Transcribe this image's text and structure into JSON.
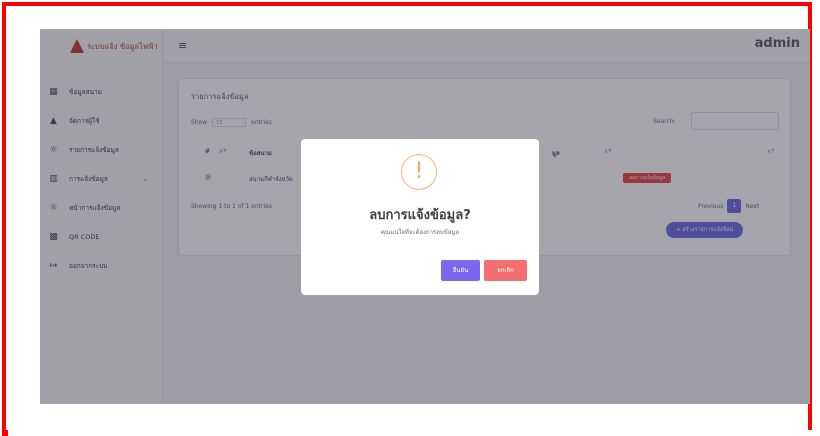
{
  "sidebar": {
    "logo_text": "ระบบแจ้ง ข้อมูลไฟฟ้า",
    "items": [
      {
        "icon": "grid-icon",
        "glyph": "▦",
        "label": "ข้อมูลสนาม"
      },
      {
        "icon": "user-icon",
        "glyph": "▲",
        "label": "จัดการผู้ใช้"
      },
      {
        "icon": "bulb-icon",
        "glyph": "☼",
        "label": "รายการแจ้งข้อมูล"
      },
      {
        "icon": "chart-icon",
        "glyph": "▥",
        "label": "การแจ้งข้อมูล",
        "has_chevron": true
      },
      {
        "icon": "bulb-icon",
        "glyph": "☼",
        "label": "หน้าการแจ้งข้อมูล"
      },
      {
        "icon": "qr-icon",
        "glyph": "▩",
        "label": "QR CODE"
      },
      {
        "icon": "logout-icon",
        "glyph": "↦",
        "label": "ออกจากระบบ"
      }
    ]
  },
  "topbar": {
    "menu_glyph": "≡",
    "user": "admin"
  },
  "card": {
    "title": "รายการแจ้งข้อมูล",
    "show_label": "Show",
    "show_value": "10",
    "entries_label": "entries",
    "search_label": "Search:",
    "columns": [
      "#",
      "ข้อสนาม",
      "มูล"
    ],
    "row": {
      "index": "@",
      "field": "สนามกีฬาจังหวัด",
      "status": "ลบการแจ้งข้อมูล"
    },
    "showing": "Showing 1 to 1 of 1 entries",
    "previous": "Previous",
    "page": "1",
    "next": "Next",
    "create_button": "+ สร้างรายการแจ้งข้อม"
  },
  "modal": {
    "icon_glyph": "!",
    "title": "ลบการแจ้งข้อมูล?",
    "text": "คุณแน่ใจที่จะต้องการลบข้อมูล",
    "confirm": "ยืนยัน",
    "cancel": "ยกเลิก"
  },
  "colors": {
    "accent": "#6b6ae6",
    "danger": "#f36f6f",
    "warning": "#f4b183",
    "frame": "#ff0000"
  }
}
